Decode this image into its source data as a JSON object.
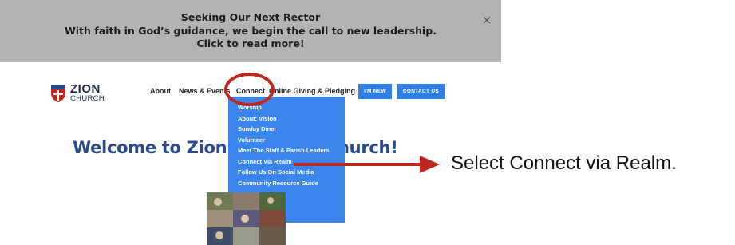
{
  "announcement": {
    "line1": "Seeking Our Next Rector",
    "line2": "With faith in God’s guidance, we begin the call to new leadership.",
    "line3": "Click to read more!",
    "close": "×"
  },
  "logo": {
    "name": "ZION",
    "sub": "CHURCH"
  },
  "nav": {
    "about": "About",
    "news": "News & Events",
    "connect": "Connect",
    "giving": "Online Giving & Pledging",
    "im_new": "I'M NEW",
    "contact": "CONTACT US"
  },
  "welcome": "Welcome to Zion Episcopal Church!",
  "dropdown": [
    "Worship",
    "About: Vision",
    "Sunday Diner",
    "Volunteer",
    "Meet The Staff & Parish Leaders",
    "Connect Via Realm",
    "Follow Us On Social Media",
    "Community Resource Guide"
  ],
  "annotation": {
    "text": "Select Connect via Realm."
  },
  "colors": {
    "banner": "#b3b3b3",
    "brand_blue": "#2f7fe6",
    "dropdown": "#3a86ee",
    "heading": "#2b4a8c",
    "annotation_red": "#c0281d"
  }
}
